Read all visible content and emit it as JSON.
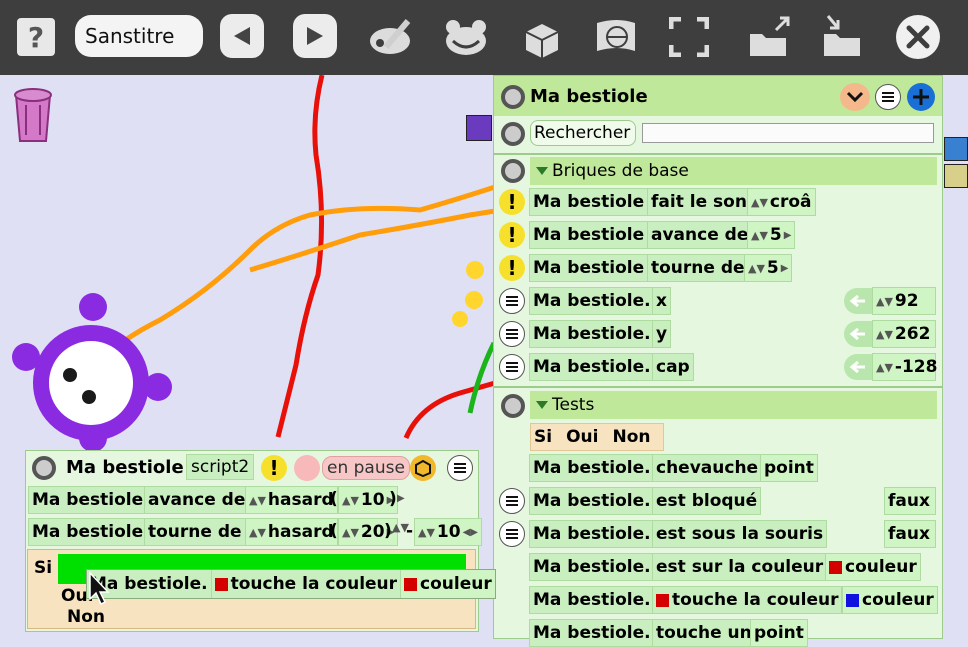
{
  "toolbar": {
    "help": "?",
    "project_title": "Sanstitre"
  },
  "main_panel": {
    "title": "Ma bestiole",
    "search_label": "Rechercher",
    "search_value": "",
    "section_basic": "Briques de base",
    "basic_bricks": [
      {
        "obj": "Ma bestiole",
        "verb": "fait le son",
        "arg": "croâ"
      },
      {
        "obj": "Ma bestiole",
        "verb": "avance de",
        "arg": "5"
      },
      {
        "obj": "Ma bestiole",
        "verb": "tourne de",
        "arg": "5"
      }
    ],
    "watchers": [
      {
        "obj": "Ma bestiole.",
        "prop": "x",
        "value": "92"
      },
      {
        "obj": "Ma bestiole.",
        "prop": "y",
        "value": "262"
      },
      {
        "obj": "Ma bestiole.",
        "prop": "cap",
        "value": "-128"
      }
    ],
    "section_tests": "Tests",
    "if_block": {
      "si": "Si",
      "oui": "Oui",
      "non": "Non"
    },
    "tests": [
      {
        "obj": "Ma bestiole.",
        "pred": "chevauche",
        "arg": "point"
      },
      {
        "obj": "Ma bestiole.",
        "pred": "est bloqué",
        "value": "faux"
      },
      {
        "obj": "Ma bestiole.",
        "pred": "est sous la souris",
        "value": "faux"
      },
      {
        "obj": "Ma bestiole.",
        "pred": "est sur la couleur",
        "arg": "couleur"
      },
      {
        "obj": "Ma bestiole.",
        "pred": "touche la couleur",
        "arg": "couleur"
      },
      {
        "obj": "Ma bestiole.",
        "pred": "touche un",
        "arg": "point"
      }
    ]
  },
  "script_panel": {
    "title": "Ma bestiole",
    "script_name": "script2",
    "status": "en pause",
    "line1": {
      "obj": "Ma bestiole",
      "verb": "avance de",
      "fn": "hasard",
      "open": "(",
      "arg": "10",
      "close": ")"
    },
    "line2": {
      "obj": "Ma bestiole",
      "verb": "tourne de",
      "fn": "hasard",
      "open": "(",
      "arg1": "20",
      "close": ")",
      "minus": "-",
      "arg2": "10"
    },
    "if_block": {
      "si": "Si",
      "oui": "Oui",
      "non": "Non"
    },
    "dragged": {
      "obj": "Ma bestiole.",
      "pred": "touche la couleur",
      "arg": "couleur"
    }
  },
  "colors": {
    "toolbar_bg": "#3e3e3e",
    "canvas_bg": "#e0e0f5",
    "panel_bg": "#e6f7e0",
    "header_green": "#bfe89a",
    "brick_green": "#c9eec0",
    "accent_blue": "#1a6fd6",
    "creature_purple": "#8a2be2"
  }
}
